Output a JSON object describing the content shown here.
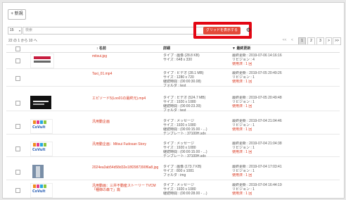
{
  "toolbar": {
    "add_label": "+ 新規"
  },
  "controls": {
    "per_page": "15",
    "search_placeholder": "検索",
    "grid_button_label": "グリッドを表示する",
    "settings_icon": "gear-icon"
  },
  "pagination": {
    "range_info": "22 の 1 から 10 へ",
    "first": "<<",
    "prev": "<",
    "pages": [
      "1",
      "2",
      "3"
    ],
    "active_page": "1",
    "next": ">",
    "last": ">>"
  },
  "table": {
    "columns": {
      "name": "名前",
      "details": "詳細",
      "updated": "最終更新"
    },
    "rows": [
      {
        "name": "mitsui.jpg",
        "thumb": "logo",
        "details": [
          "タイプ : 画像 (28.8 KB)",
          "サイズ : 648 x 330"
        ],
        "updated": [
          "最終更新 : 2019-07-06 14:16:16",
          "リビジョン : 4",
          "使用済 : 1 回"
        ]
      },
      {
        "name": "Taxi_01.mp4",
        "thumb": "none",
        "details": [
          "タイプ : ビデオ (28.1 MB)",
          "サイズ : 1280 x 720",
          "継続時間 : (00:00:30.08)",
          "フォルダ : test"
        ],
        "updated": [
          "最終更新 : 2019-07-05 20:49:26",
          "リビジョン : 1",
          "使用済 : 1 回"
        ]
      },
      {
        "name": "エピソード5(Loo01の最終元).mp4",
        "thumb": "dark",
        "details": [
          "タイプ : ビデオ (524.7 MB)",
          "サイズ : 1920 x 1080",
          "継続時間 : (00:00:23.39)",
          "フォルダ : test"
        ],
        "updated": [
          "最終更新 : 2019-07-05 20:49:48",
          "リビジョン : 1",
          "使用済 : 1 回"
        ]
      },
      {
        "name": "汎用動企画",
        "thumb": "civil",
        "details": [
          "タイプ : メッセージ",
          "サイズ : 1920 x 1080",
          "継続時間 : (00:00:15.00 - ...)",
          "テンプレート : 37100H.sdx"
        ],
        "updated": [
          "最終更新 : 2019-07-04 21:04:46",
          "リビジョン : 1",
          "使用済 : 1 回"
        ]
      },
      {
        "name": "汎用動企画：Mitsui Fudosan Story",
        "thumb": "civil",
        "details": [
          "タイプ : メッセージ",
          "サイズ : 1920 x 1080",
          "継続時間 : (00:00:15.00 - ...)",
          "テンプレート : 37100H.sdx"
        ],
        "updated": [
          "最終更新 : 2019-07-04 21:04:38",
          "リビジョン : 1",
          "使用済 : 1 回"
        ]
      },
      {
        "name": "2024ea3ab54d58d32e18f2987390f6a8.jpg",
        "thumb": "tower",
        "details": [
          "タイプ : 画像 (173.7 KB)",
          "サイズ : 800 x 1081",
          "フォルダ : img"
        ],
        "updated": [
          "最終更新 : 2019-07-04 17:03:41",
          "リビジョン : 1",
          "使用済 : 1 回"
        ]
      },
      {
        "name": "汎用動画：三井不動産ストーリー TVCM「種御の森で」篇",
        "thumb": "civil",
        "details": [
          "タイプ : メッセージ",
          "サイズ : 1920 x 1080",
          "継続時間 : (00:00:28.00 - ...)"
        ],
        "updated": [
          "最終更新 : 2019-07-04 16:44:19",
          "リビジョン : 1",
          "使用済 : 1 回"
        ]
      }
    ]
  }
}
